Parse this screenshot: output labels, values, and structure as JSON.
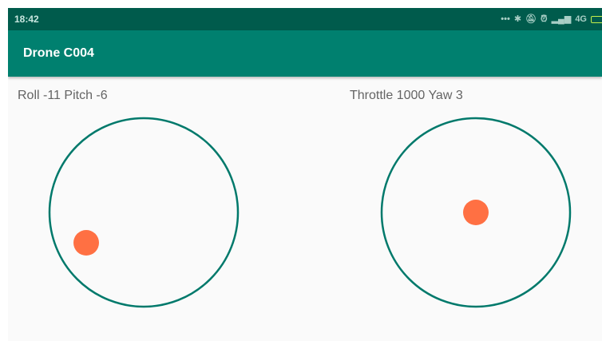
{
  "status_bar": {
    "time": "18:42",
    "icons": [
      "more-dots-icon",
      "bluetooth-icon",
      "bell-off-icon",
      "alarm-icon",
      "signal-icon",
      "network-4g-icon",
      "battery-charging-icon"
    ],
    "network_label": "4G"
  },
  "app_bar": {
    "title": "Drone C004"
  },
  "left_stick": {
    "label": "Roll -11 Pitch -6"
  },
  "right_stick": {
    "label": "Throttle 1000 Yaw 3"
  },
  "colors": {
    "status_bar": "#005b4c",
    "app_bar": "#00806f",
    "joystick_ring": "#00796b",
    "knob": "#ff7043",
    "background": "#fafafa"
  }
}
